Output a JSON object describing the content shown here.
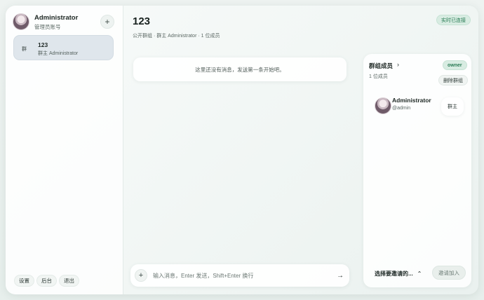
{
  "sidebar": {
    "user_name": "Administrator",
    "user_role": "管理员账号",
    "add_label": "+",
    "group": {
      "icon_text": "群",
      "title": "123",
      "subtitle": "群主 Administrator"
    },
    "buttons": {
      "settings": "设置",
      "admin": "后台",
      "logout": "退出"
    }
  },
  "main": {
    "title": "123",
    "subtitle": "公开群组 · 群主 Administrator · 1 位成员",
    "status": "实时已连接",
    "empty_message": "这里还没有消息，发送第一条开始吧。",
    "composer": {
      "plus_label": "+",
      "placeholder": "输入消息，Enter 发送，Shift+Enter 换行",
      "send_icon": "→"
    }
  },
  "panel": {
    "title": "群组成员",
    "chevron": "›",
    "member_count": "1 位成员",
    "owner_badge": "owner",
    "delete_label": "删除群组",
    "members": [
      {
        "name": "Administrator",
        "handle": "@admin",
        "role": "群主"
      }
    ],
    "invite_select": "选择要邀请的...",
    "invite_chevron": "⌃",
    "invite_button": "邀请加入"
  },
  "colors": {
    "accent_green": "#267a52",
    "badge_bg": "#d8ece2",
    "selected_item": "#dfe6ec"
  },
  "icons": {
    "add": "plus-icon",
    "send": "arrow-right-icon",
    "chevron": "chevron-right-icon",
    "invite_chevron": "chevron-up-icon"
  }
}
